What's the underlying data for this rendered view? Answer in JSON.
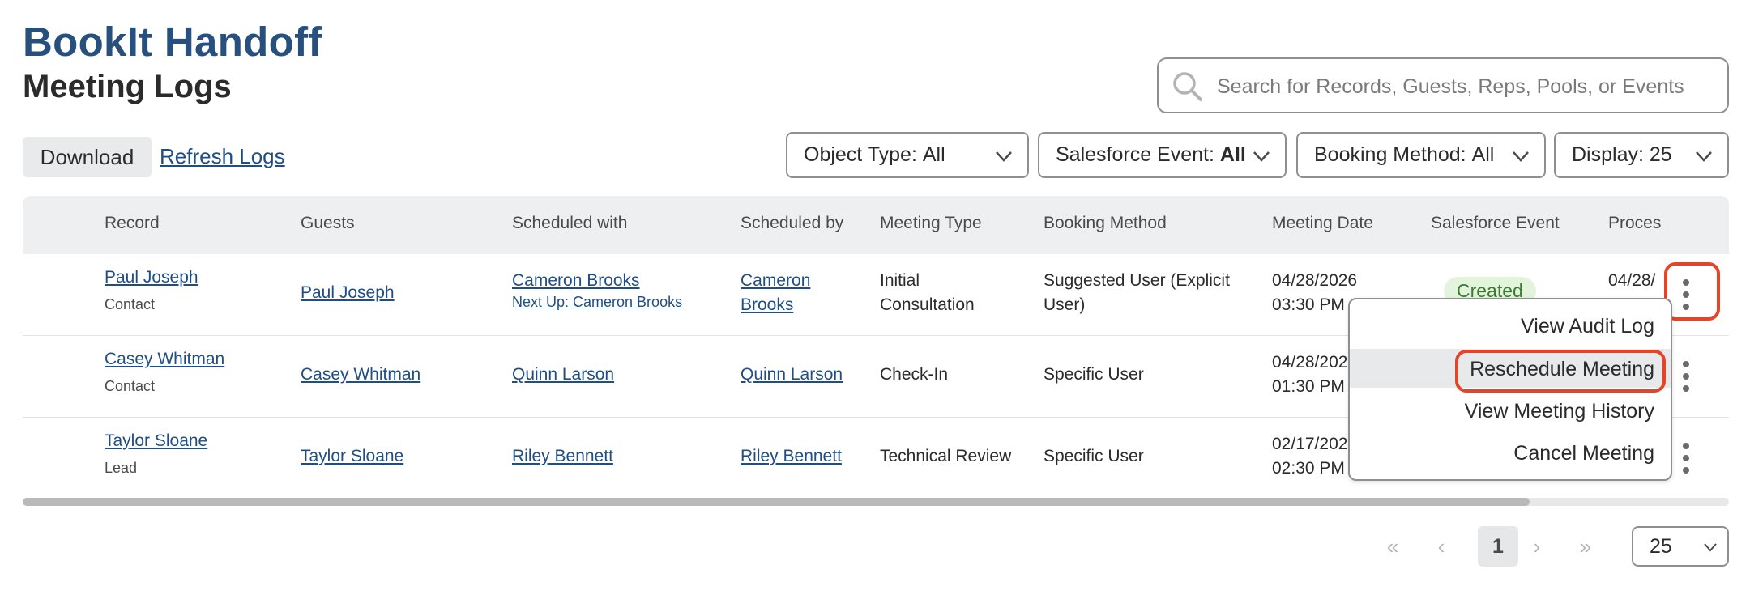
{
  "header": {
    "app_title": "BookIt Handoff",
    "page_title": "Meeting Logs"
  },
  "search": {
    "placeholder": "Search for Records, Guests, Reps, Pools, or Events",
    "value": ""
  },
  "toolbar": {
    "download_label": "Download",
    "refresh_label": "Refresh Logs"
  },
  "filters": {
    "object_type": {
      "prefix": "Object Type: ",
      "value": "All"
    },
    "salesforce_event": {
      "prefix": "Salesforce Event: ",
      "value": "All"
    },
    "booking_method": {
      "prefix": "Booking Method: ",
      "value": "All"
    },
    "display": {
      "prefix": "Display: ",
      "value": "25"
    }
  },
  "table": {
    "columns": [
      "Record",
      "Guests",
      "Scheduled with",
      "Scheduled by",
      "Meeting Type",
      "Booking Method",
      "Meeting Date",
      "Salesforce Event",
      "Proces"
    ],
    "rows": [
      {
        "record": "Paul Joseph",
        "record_type": "Contact",
        "guests": "Paul Joseph",
        "scheduled_with": "Cameron Brooks",
        "scheduled_with_sub": "Next Up: Cameron Brooks",
        "scheduled_by_line1": "Cameron",
        "scheduled_by_line2": "Brooks",
        "meeting_type_line1": "Initial",
        "meeting_type_line2": "Consultation",
        "booking_method_line1": "Suggested User (Explicit",
        "booking_method_line2": "User)",
        "meeting_date": "04/28/2026",
        "meeting_time": "03:30 PM",
        "salesforce_event": "Created",
        "processed": "04/28/"
      },
      {
        "record": "Casey Whitman",
        "record_type": "Contact",
        "guests": "Casey Whitman",
        "scheduled_with": "Quinn Larson",
        "scheduled_by": "Quinn Larson",
        "meeting_type": "Check-In",
        "booking_method": "Specific User",
        "meeting_date": "04/28/202",
        "meeting_time": "01:30 PM"
      },
      {
        "record": "Taylor Sloane",
        "record_type": "Lead",
        "guests": "Taylor Sloane",
        "scheduled_with": "Riley Bennett",
        "scheduled_by": "Riley Bennett",
        "meeting_type": "Technical Review",
        "booking_method": "Specific User",
        "meeting_date": "02/17/202",
        "meeting_time": "02:30 PM"
      }
    ]
  },
  "row_menu": {
    "items": [
      "View Audit Log",
      "Reschedule Meeting",
      "View Meeting History",
      "Cancel Meeting"
    ],
    "hovered": "Reschedule Meeting"
  },
  "pagination": {
    "first": "«",
    "prev": "‹",
    "current_page": "1",
    "next": "›",
    "last": "»",
    "page_size": "25"
  },
  "colors": {
    "brand": "#27507e",
    "link": "#1f4e86",
    "highlight": "#e24527",
    "badge_bg": "#e3f4dd",
    "badge_text": "#3d7a34"
  }
}
